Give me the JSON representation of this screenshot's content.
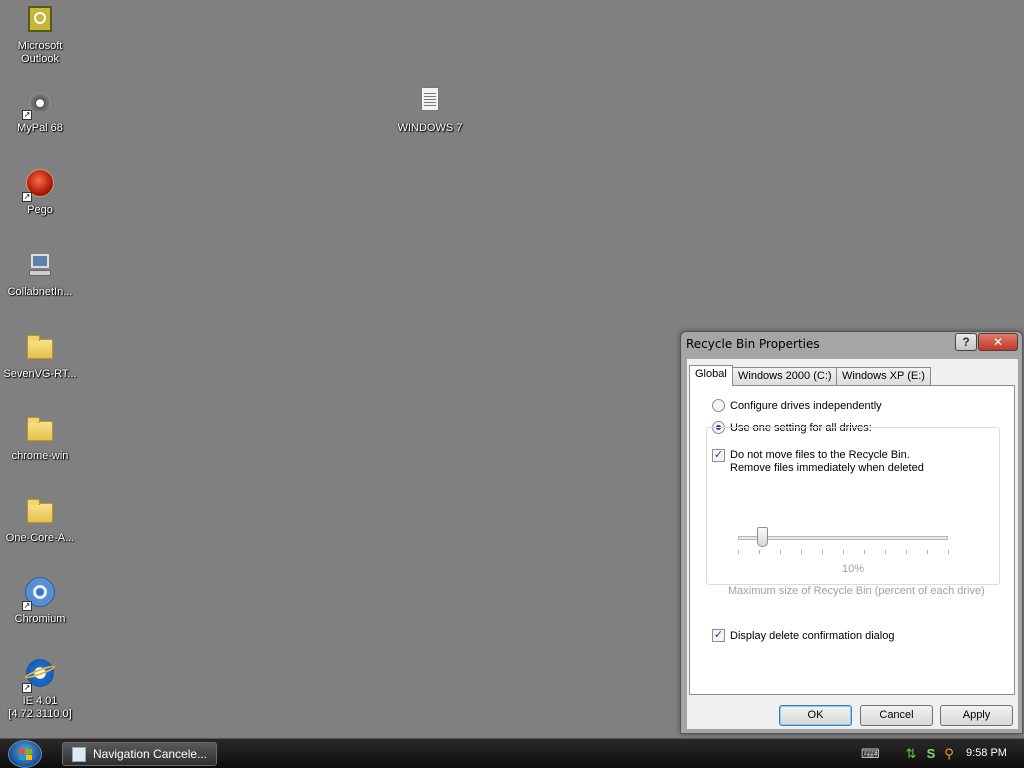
{
  "desktop_icons": [
    {
      "id": "outlook",
      "label": "Microsoft\nOutlook",
      "icon": "outlook-icon"
    },
    {
      "id": "mypal",
      "label": "MyPal 68",
      "icon": "raccoon-icon"
    },
    {
      "id": "pego",
      "label": "Pego",
      "icon": "pego-icon"
    },
    {
      "id": "collabnet",
      "label": "CollabnetIn...",
      "icon": "computer-icon"
    },
    {
      "id": "sevenvg",
      "label": "SevenVG-RT...",
      "icon": "folder-icon"
    },
    {
      "id": "chromewin",
      "label": "chrome-win",
      "icon": "folder-icon"
    },
    {
      "id": "onecore",
      "label": "One-Core-A...",
      "icon": "folder-icon"
    },
    {
      "id": "chromium",
      "label": "Chromium",
      "icon": "chromium-icon"
    },
    {
      "id": "ie",
      "label": "IE 4.01\n[4.72.3110.0]",
      "icon": "ie-icon"
    },
    {
      "id": "windows7",
      "label": "WINDOWS 7",
      "icon": "text-file-icon"
    }
  ],
  "dialog": {
    "title": "Recycle Bin Properties",
    "help_label": "?",
    "close_label": "✕",
    "tabs": [
      {
        "label": "Global",
        "active": true
      },
      {
        "label": "Windows 2000 (C:)",
        "active": false
      },
      {
        "label": "Windows XP (E:)",
        "active": false
      }
    ],
    "radio_independent": "Configure drives independently",
    "radio_all": "Use one setting for all drives:",
    "check_no_move_line1": "Do not move files to the Recycle Bin.",
    "check_no_move_line2": "Remove files immediately when deleted",
    "slider_percent": "10%",
    "slider_value": 10,
    "slider_caption": "Maximum size of Recycle Bin (percent of each drive)",
    "check_confirm": "Display delete confirmation dialog",
    "checkmark": "✓",
    "buttons": {
      "ok": "OK",
      "cancel": "Cancel",
      "apply": "Apply"
    }
  },
  "taskbar": {
    "task_label": "Navigation Cancele...",
    "clock": "9:58 PM"
  }
}
